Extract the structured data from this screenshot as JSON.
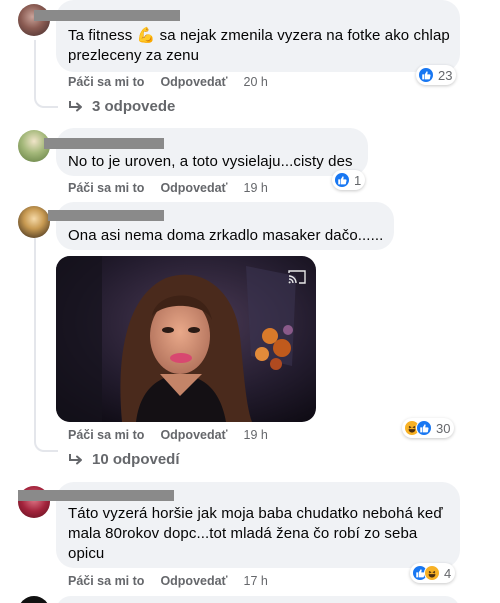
{
  "comments": [
    {
      "text": "Ta fitness 💪 sa nejak zmenila vyzera na fotke ako chlap prezleceny za zenu",
      "like": "Páči sa mi to",
      "reply": "Odpovedať",
      "time": "20 h",
      "reaction_count": "23",
      "replies": "3 odpovede"
    },
    {
      "text": "No to je uroven, a toto vysielaju...cisty des",
      "like": "Páči sa mi to",
      "reply": "Odpovedať",
      "time": "19 h",
      "reaction_count": "1"
    },
    {
      "text": "Ona asi nema doma zrkadlo masaker dačo......",
      "like": "Páči sa mi to",
      "reply": "Odpovedať",
      "time": "19 h",
      "reaction_count": "30",
      "replies": "10 odpovedí"
    },
    {
      "text": "Táto vyzerá horšie jak moja baba chudatko nebohá keď mala 80rokov dopc...tot mladá žena čo robí zo seba opicu",
      "like": "Páči sa mi to",
      "reply": "Odpovedať",
      "time": "17 h",
      "reaction_count": "4"
    }
  ],
  "colors": {
    "bubble": "#f0f2f5",
    "meta_text": "#65676b",
    "like_blue": "#1877f2",
    "haha_yellow": "#f7b125"
  }
}
